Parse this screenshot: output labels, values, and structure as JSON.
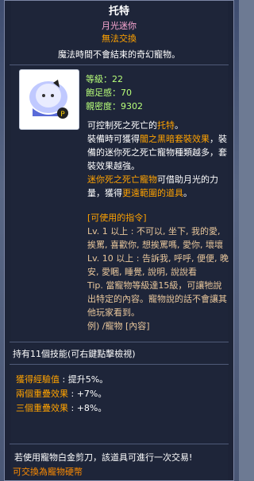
{
  "tooltip": {
    "title": "托特",
    "subtitle": "月光迷你",
    "untradeable": "無法交換",
    "description": "魔法時間不會結束的奇幻寵物。"
  },
  "stats": {
    "level": "等級：22",
    "fullness": "飽足感：70",
    "closeness": "親密度：9302"
  },
  "body": {
    "line1_a": "可控制死之死亡的",
    "line1_b": "托特",
    "line1_c": "。",
    "line2_a": "裝備時可獲得",
    "line2_b": "闇之黑暗套裝效果",
    "line2_c": "，裝備的迷你死之死亡寵物種類越多，套裝效果越強。",
    "line3_a": "迷你死之死亡寵物",
    "line3_b": "可借助月光的力量，獲得",
    "line3_c": "更遠範圍的道具",
    "line3_d": "。"
  },
  "commands": {
    "header": "[可使用的指令]",
    "lv1": "Lv. 1 以上 : 不可以, 坐下, 我的愛, 挨罵, 喜歡你, 想挨罵嗎, 愛你, 壞壞",
    "lv10": "Lv. 10 以上 : 告訴我, 呼呼, 便便, 晚安, 愛睏, 睡覺, 說明, 說說看",
    "tip": "Tip. 當寵物等級達15級，可讓牠說出特定的內容。寵物說的話不會讓其他玩家看到。",
    "example": "例) /寵物 [內容]"
  },
  "skills": {
    "header": "持有11個技能(可右鍵點擊檢視)",
    "items": [
      {
        "name": "獲得經驗值",
        "value": " : 提升5%。"
      },
      {
        "name": "兩個重疊效果",
        "value": " : +7%。"
      },
      {
        "name": "三個重疊效果",
        "value": " : +8%。"
      }
    ]
  },
  "footer": {
    "line1": "若使用寵物白金剪刀，該道具可進行一次交易!",
    "line2": "可交換為寵物硬幣"
  }
}
